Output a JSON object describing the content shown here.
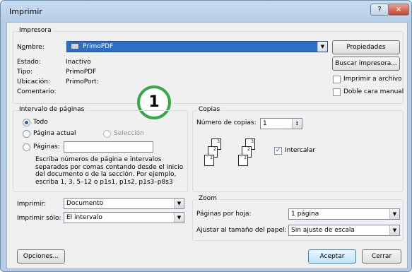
{
  "window": {
    "title": "Imprimir",
    "help": "?",
    "close": "×"
  },
  "printer": {
    "group": "Impresora",
    "name_label_pre": "N",
    "name_label_u": "o",
    "name_label_post": "mbre:",
    "name_value": "PrimoPDF",
    "estado_label": "Estado:",
    "estado_value": "Inactivo",
    "tipo_label": "Tipo:",
    "tipo_value": "PrimoPDF",
    "ubicacion_label": "Ubicación:",
    "ubicacion_value": "PrimoPort:",
    "comentario_label": "Comentario:",
    "propiedades": "Propiedades",
    "buscar": "Buscar impresora...",
    "imprimir_archivo": "Imprimir a archivo",
    "doble_cara": "Doble cara manual"
  },
  "badge": "1",
  "range": {
    "group": "Intervalo de páginas",
    "todo": "Todo",
    "actual": "Página actual",
    "seleccion": "Selección",
    "paginas": "Páginas:",
    "help": [
      "Escriba números de página e intervalos",
      "separados por comas contando desde el inicio",
      "del documento o de la sección. Por ejemplo,",
      "escriba 1, 3, 5–12 o p1s1, p1s2, p1s3–p8s3"
    ]
  },
  "copies": {
    "group": "Copias",
    "num_label": "Número de copias:",
    "num_value": "1",
    "intercalar": "Intercalar"
  },
  "print": {
    "imprimir_label": "Imprimir:",
    "imprimir_value": "Documento",
    "solo_label": "Imprimir sólo:",
    "solo_value": "El intervalo"
  },
  "zoom": {
    "group": "Zoom",
    "por_hoja_label": "Páginas por hoja:",
    "por_hoja_value": "1 página",
    "ajustar_label": "Ajustar al tamaño del papel:",
    "ajustar_value": "Sin ajuste de escala"
  },
  "footer": {
    "opciones": "Opciones...",
    "aceptar": "Aceptar",
    "cerrar": "Cerrar"
  }
}
